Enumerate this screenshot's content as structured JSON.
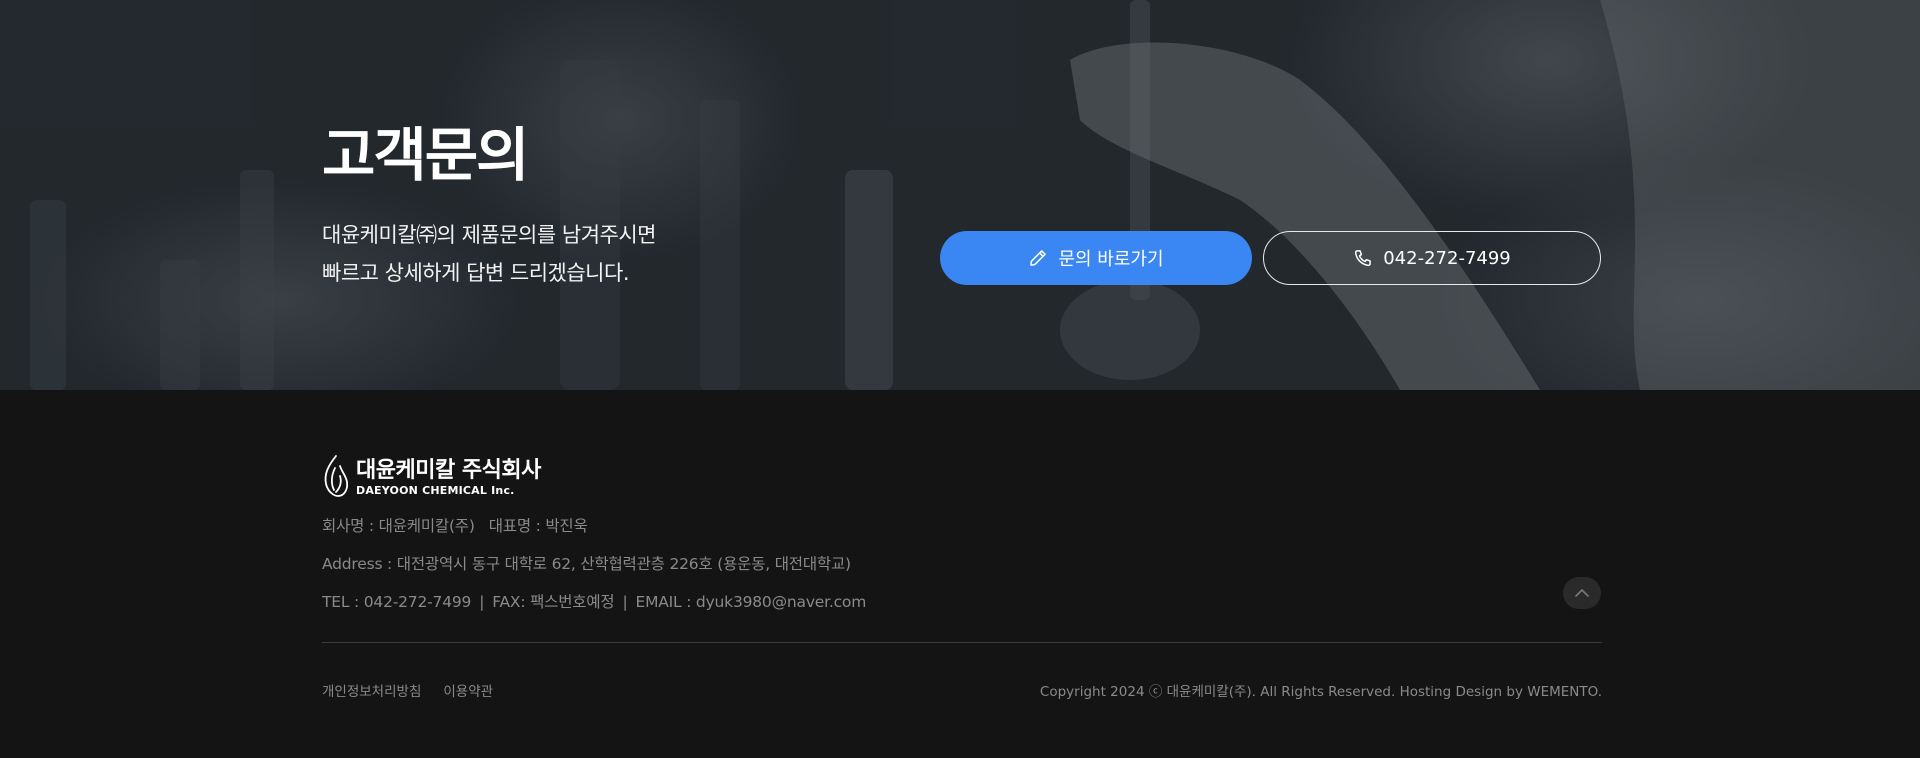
{
  "hero": {
    "title": "고객문의",
    "desc_line1": "대윤케미칼㈜의 제품문의를 남겨주시면",
    "desc_line2": "빠르고 상세하게 답변 드리겠습니다.",
    "inquiry_button": "문의 바로가기",
    "phone_button": "042-272-7499",
    "accent_color": "#3a86f2"
  },
  "footer": {
    "logo_ko": "대윤케미칼 주식회사",
    "logo_en": "DAEYOON CHEMICAL Inc.",
    "company": "회사명 : 대윤케미칼(주)",
    "ceo": "대표명 : 박진욱",
    "address": "Address  : 대전광역시 동구 대학로 62, 산학협력관층 226호 (용운동, 대전대학교)",
    "tel": "TEL : 042-272-7499",
    "fax": "FAX:  팩스번호예정",
    "email": "EMAIL : dyuk3980@naver.com",
    "privacy_link": "개인정보처리방침",
    "terms_link": "이용약관",
    "copyright": "Copyright 2024 ⓒ 대윤케미칼(주). All Rights Reserved. Hosting Design by WEMENTO."
  },
  "icons": {
    "inquiry": "pencil-icon",
    "phone": "phone-icon",
    "scroll_top": "chevron-up-icon",
    "logo": "flame-logo-icon"
  }
}
